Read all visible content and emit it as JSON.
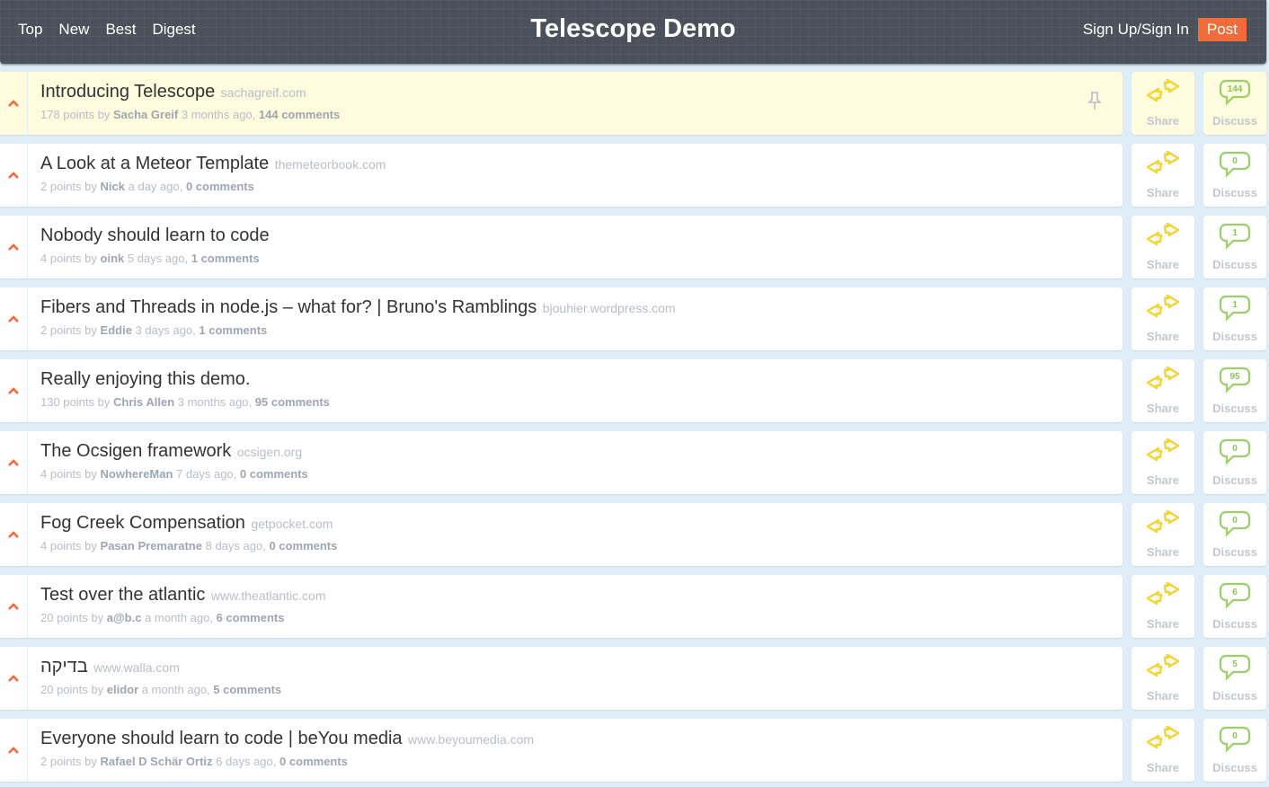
{
  "header": {
    "nav": [
      "Top",
      "New",
      "Best",
      "Digest"
    ],
    "title": "Telescope Demo",
    "sign_in": "Sign Up/Sign In",
    "post": "Post"
  },
  "colors": {
    "accent": "#f26b3a",
    "share": "#f2d528",
    "discuss": "#9ccf6a",
    "highlight": "#fefbdf"
  },
  "labels": {
    "share": "Share",
    "discuss": "Discuss"
  },
  "posts": [
    {
      "title": "Introducing Telescope",
      "domain": "sachagreif.com",
      "points": "178 points",
      "by": "by",
      "author": "Sacha Greif",
      "time": "3 months ago,",
      "comments": "144 comments",
      "count": "144",
      "pinned": true
    },
    {
      "title": "A Look at a Meteor Template",
      "domain": "themeteorbook.com",
      "points": "2 points",
      "by": "by",
      "author": "Nick",
      "time": "a day ago,",
      "comments": "0 comments",
      "count": "0"
    },
    {
      "title": "Nobody should learn to code",
      "domain": "",
      "points": "4 points",
      "by": "by",
      "author": "oink",
      "time": "5 days ago,",
      "comments": "1 comments",
      "count": "1"
    },
    {
      "title": "Fibers and Threads in node.js – what for? | Bruno's Ramblings",
      "domain": "bjouhier.wordpress.com",
      "points": "2 points",
      "by": "by",
      "author": "Eddie",
      "time": "3 days ago,",
      "comments": "1 comments",
      "count": "1"
    },
    {
      "title": "Really enjoying this demo.",
      "domain": "",
      "points": "130 points",
      "by": "by",
      "author": "Chris Allen",
      "time": "3 months ago,",
      "comments": "95 comments",
      "count": "95"
    },
    {
      "title": "The Ocsigen framework",
      "domain": "ocsigen.org",
      "points": "4 points",
      "by": "by",
      "author": "NowhereMan",
      "time": "7 days ago,",
      "comments": "0 comments",
      "count": "0"
    },
    {
      "title": "Fog Creek Compensation",
      "domain": "getpocket.com",
      "points": "4 points",
      "by": "by",
      "author": "Pasan Premaratne",
      "time": "8 days ago,",
      "comments": "0 comments",
      "count": "0"
    },
    {
      "title": "Test over the atlantic",
      "domain": "www.theatlantic.com",
      "points": "20 points",
      "by": "by",
      "author": "a@b.c",
      "time": "a month ago,",
      "comments": "6 comments",
      "count": "6"
    },
    {
      "title": "בדיקה",
      "domain": "www.walla.com",
      "points": "20 points",
      "by": "by",
      "author": "elidor",
      "time": "a month ago,",
      "comments": "5 comments",
      "count": "5"
    },
    {
      "title": "Everyone should learn to code | beYou media",
      "domain": "www.beyoumedia.com",
      "points": "2 points",
      "by": "by",
      "author": "Rafael D Schär Ortiz",
      "time": "6 days ago,",
      "comments": "0 comments",
      "count": "0"
    }
  ]
}
